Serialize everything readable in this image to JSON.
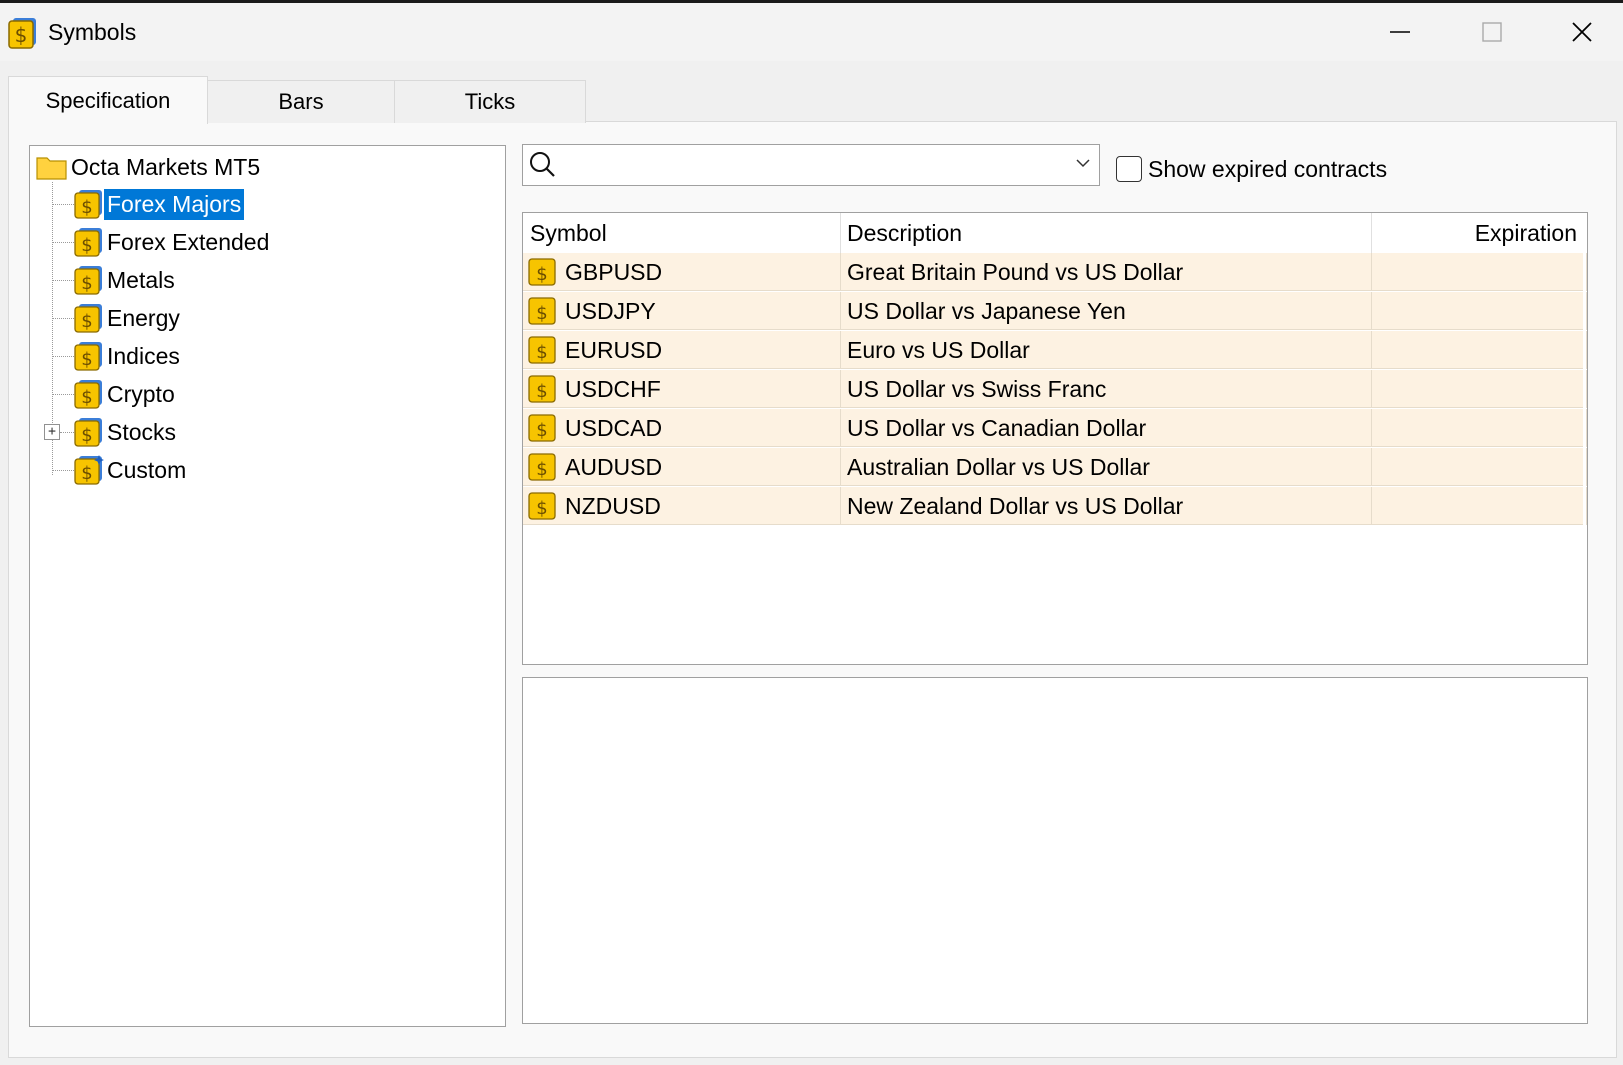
{
  "window": {
    "title": "Symbols",
    "app_icon": "dollar-coin-icon"
  },
  "tabs": [
    {
      "label": "Specification",
      "active": true
    },
    {
      "label": "Bars",
      "active": false
    },
    {
      "label": "Ticks",
      "active": false
    }
  ],
  "tree": {
    "root": {
      "label": "Octa Markets MT5",
      "icon": "folder-icon"
    },
    "items": [
      {
        "label": "Forex Majors",
        "selected": true
      },
      {
        "label": "Forex Extended"
      },
      {
        "label": "Metals"
      },
      {
        "label": "Energy"
      },
      {
        "label": "Indices"
      },
      {
        "label": "Crypto"
      },
      {
        "label": "Stocks",
        "expandable": true
      },
      {
        "label": "Custom",
        "icon": "custom-symbol-icon"
      }
    ]
  },
  "search": {
    "value": "",
    "placeholder": ""
  },
  "show_expired": {
    "label": "Show expired contracts",
    "checked": false
  },
  "table": {
    "columns": [
      "Symbol",
      "Description",
      "Expiration"
    ],
    "rows": [
      {
        "symbol": "GBPUSD",
        "description": "Great Britain Pound vs US Dollar",
        "expiration": ""
      },
      {
        "symbol": "USDJPY",
        "description": "US Dollar vs Japanese Yen",
        "expiration": ""
      },
      {
        "symbol": "EURUSD",
        "description": "Euro vs US Dollar",
        "expiration": ""
      },
      {
        "symbol": "USDCHF",
        "description": "US Dollar vs Swiss Franc",
        "expiration": ""
      },
      {
        "symbol": "USDCAD",
        "description": "US Dollar vs Canadian Dollar",
        "expiration": ""
      },
      {
        "symbol": "AUDUSD",
        "description": "Australian Dollar vs US Dollar",
        "expiration": ""
      },
      {
        "symbol": "NZDUSD",
        "description": "New Zealand Dollar vs US Dollar",
        "expiration": ""
      }
    ]
  },
  "colors": {
    "selection": "#0078d7",
    "row_background": "#fdf2e2",
    "coin": "#f7c400"
  }
}
